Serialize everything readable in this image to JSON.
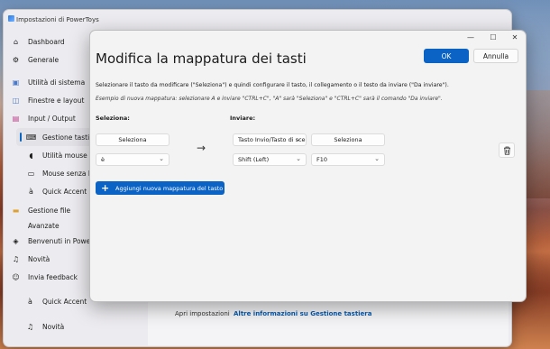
{
  "settings_window": {
    "title": "Impostazioni di PowerToys",
    "nav": [
      {
        "label": "Dashboard",
        "icon": "home-icon"
      },
      {
        "label": "Generale",
        "icon": "gear-icon"
      },
      {
        "label": "Utilità di sistema",
        "icon": "system-icon"
      },
      {
        "label": "Finestre e layout",
        "icon": "windows-layout-icon"
      },
      {
        "label": "Input / Output",
        "icon": "input-output-icon"
      },
      {
        "label": "Gestione tastiera",
        "icon": "keyboard-icon"
      },
      {
        "label": "Utilità mouse",
        "icon": "mouse-icon"
      },
      {
        "label": "Mouse senza bordi",
        "icon": "mouse-borderless-icon"
      },
      {
        "label": "Quick Accent",
        "icon": "accent-icon"
      },
      {
        "label": "Gestione file",
        "icon": "folder-icon"
      },
      {
        "label": "Avanzate",
        "icon": "advanced-icon"
      },
      {
        "label": "Benvenuti in PowerToys",
        "icon": "welcome-icon"
      },
      {
        "label": "Novità",
        "icon": "bell-icon"
      },
      {
        "label": "Invia feedback",
        "icon": "feedback-icon"
      }
    ],
    "bottom_nav": [
      {
        "label": "Quick Accent",
        "icon": "accent-icon"
      },
      {
        "label": "Novità",
        "icon": "bell-icon"
      }
    ],
    "bottom_left_text": "Apri impostazioni",
    "bottom_link": "Altre informazioni su Gestione tastiera"
  },
  "dialog": {
    "title": "Modifica la mappatura dei tasti",
    "ok_label": "OK",
    "cancel_label": "Annulla",
    "instructions": "Selezionare il tasto da modificare (\"Seleziona\") e quindi configurare il tasto, il collegamento o il testo da inviare (\"Da inviare\").",
    "example": "Esempio di nuova mappatura: selezionare A e inviare \"CTRL+C\", \"A\" sarà \"Seleziona\" e \"CTRL+C\" sarà il comando \"Da inviare\".",
    "select_header": "Seleziona:",
    "send_header": "Inviare:",
    "mapping": {
      "select_button": "Seleziona",
      "select_value": "è",
      "send_type": "Tasto Invio/Tasto di scelta rapida",
      "send_select_button": "Seleziona",
      "modifier_value": "Shift (Left)",
      "key_value": "F10"
    },
    "add_button": "Aggiungi nuova mappatura del tasto"
  },
  "window_controls": {
    "minimize": "—",
    "maximize": "☐",
    "close": "✕"
  },
  "colors": {
    "accent": "#0b63c5",
    "dialog_bg": "#f3f3f3",
    "settings_bg": "#ecebef"
  }
}
